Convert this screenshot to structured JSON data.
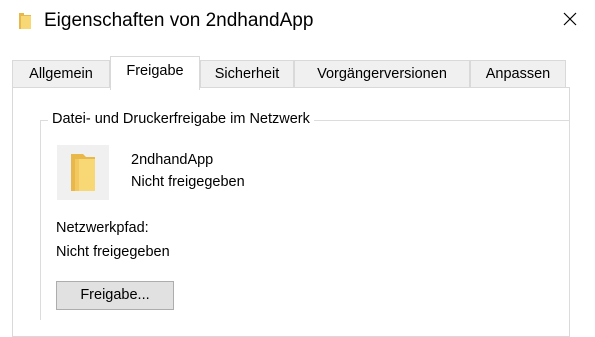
{
  "window": {
    "title": "Eigenschaften von 2ndhandApp"
  },
  "tabs": [
    {
      "label": "Allgemein",
      "active": false
    },
    {
      "label": "Freigabe",
      "active": true
    },
    {
      "label": "Sicherheit",
      "active": false
    },
    {
      "label": "Vorgängerversionen",
      "active": false
    },
    {
      "label": "Anpassen",
      "active": false
    }
  ],
  "sharing": {
    "group_title": "Datei- und Druckerfreigabe im Netzwerk",
    "folder_name": "2ndhandApp",
    "folder_status": "Nicht freigegeben",
    "network_path_label": "Netzwerkpfad:",
    "network_path_value": "Nicht freigegeben",
    "share_button_label": "Freigabe..."
  },
  "icons": {
    "title": "folder-icon",
    "close": "close-icon",
    "folder": "folder-icon"
  },
  "colors": {
    "folder_yellow": "#f8d775",
    "folder_dark": "#e8b84a",
    "border": "#d9d9d9",
    "button_bg": "#e1e1e1"
  }
}
